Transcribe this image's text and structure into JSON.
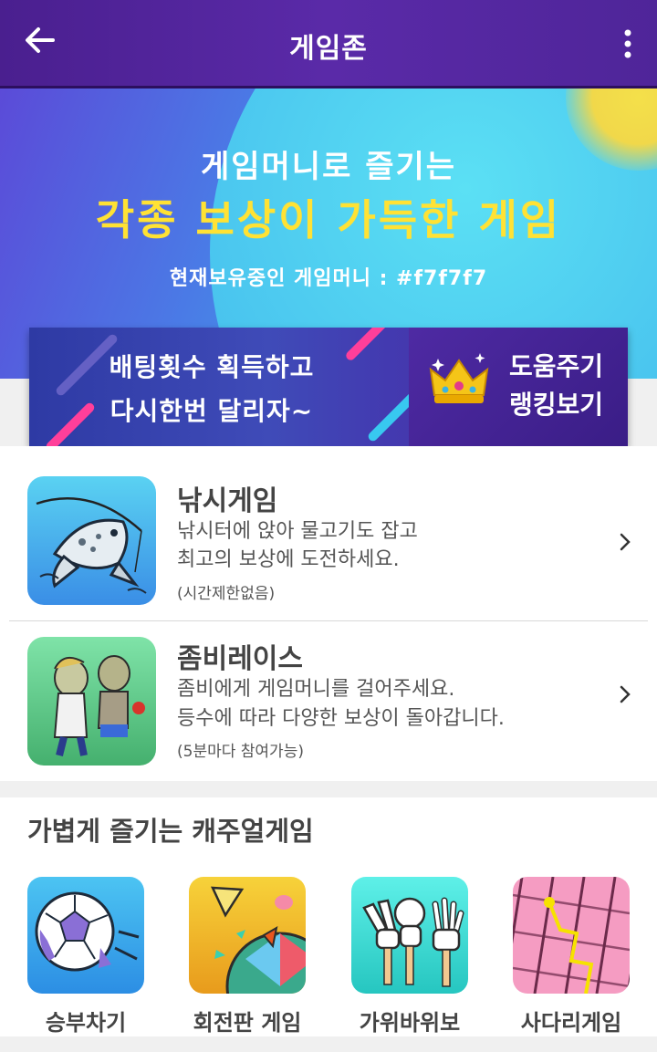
{
  "appbar": {
    "title": "게임존",
    "back_icon": "arrow-left-icon",
    "menu_icon": "more-vertical-icon"
  },
  "hero": {
    "line1": "게임머니로 즐기는",
    "line2": "각종 보상이 가득한 게임",
    "balance_text": "현재보유중인 게임머니 : #f7f7f7"
  },
  "promo": {
    "line1": "배팅횟수 획득하고",
    "line2": "다시한번 달리자~",
    "help_label": "도움주기",
    "ranking_label": "랭킹보기",
    "icon": "crown-icon"
  },
  "games": [
    {
      "name": "낚시게임",
      "desc1": "낚시터에 앉아 물고기도 잡고",
      "desc2": "최고의 보상에 도전하세요.",
      "note": "(시간제한없음)"
    },
    {
      "name": "좀비레이스",
      "desc1": "좀비에게 게임머니를 걸어주세요.",
      "desc2": "등수에 따라 다양한 보상이 돌아갑니다.",
      "note": "(5분마다 참여가능)"
    }
  ],
  "casual": {
    "title": "가볍게 즐기는 캐주얼게임",
    "items": [
      {
        "label": "승부차기"
      },
      {
        "label": "회전판 게임"
      },
      {
        "label": "가위바위보"
      },
      {
        "label": "사다리게임"
      }
    ]
  },
  "colors": {
    "appbar": "#4f2599",
    "hero_highlight": "#ffe234",
    "promo": "#3f4bb8"
  }
}
